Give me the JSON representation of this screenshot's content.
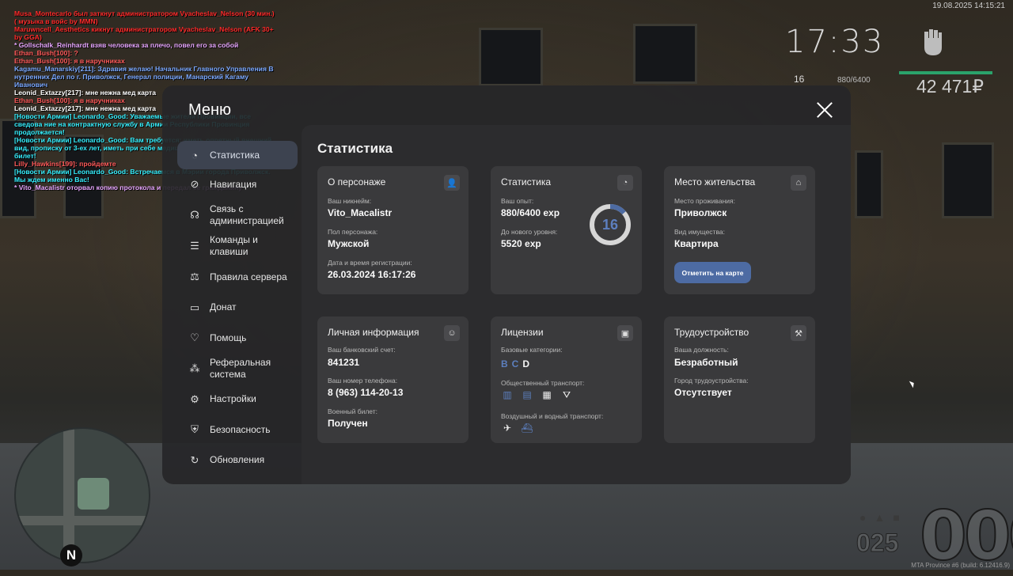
{
  "chat": [
    {
      "text": "Musa_Montecarlo был заткнут администратором Vyacheslav_Nelson (30 мин.) ( музыка в войс by MMN)",
      "color": "#ff2a2a"
    },
    {
      "text": "Maruwncell_Aesthetics кикнут администратором Vyacheslav_Nelson (AFK 30+ by GGA)",
      "color": "#ff2a2a"
    },
    {
      "text": "* Gollschalk_Reinhardt взяв человека за плечо, повел его за собой",
      "color": "#e7a6ff"
    },
    {
      "text": "Ethan_Bush[100]: ?",
      "color": "#ff5a5a"
    },
    {
      "text": "Ethan_Bush[100]: я в наручниках",
      "color": "#ff5a5a"
    },
    {
      "text": "Kagamu_Manarskiy[211]: Здравия желаю! Начальник Главного Управления В нутренних Дел по г. Приволжск, Генерал полиции, Манарский Кагаму Иванович",
      "color": "#7aa8ff"
    },
    {
      "text": "Leonid_Extazzy[217]: мне нежна мед карта",
      "color": "#ffffff"
    },
    {
      "text": "Ethan_Bush[100]: я в наручниках",
      "color": "#ff5a5a"
    },
    {
      "text": "Leonid_Extazzy[217]: мне нежна мед карта",
      "color": "#ffffff"
    },
    {
      "text": "[Новости Армии] Leonardo_Good: Уважаемые жители Провинции, все сведова ние на контрактную службу в Армии Республики Провинция продолжается!",
      "color": "#35f0ff"
    },
    {
      "text": "[Новости Армии] Leonardo_Good: Вам требуется: иметь опрятный внешний вид, прописку от 3-ех лет, иметь при себе медицинскую карточку и военный билет!",
      "color": "#35f0ff"
    },
    {
      "text": "Lilly_Hawkins[199]: пройдемте",
      "color": "#ff5a5a"
    },
    {
      "text": "[Новости Армии] Leonardo_Good: Встречаемся в Мэрии города Приволжск. Мы ждем именно Вас!",
      "color": "#35f0ff"
    },
    {
      "text": "* Vito_Macalistr оторвал копию протокола и передал ее гражданину",
      "color": "#e7a6ff"
    }
  ],
  "hud": {
    "datetime": "19.08.2025 14:15:21",
    "clock": "17:33",
    "level": "16",
    "exp": "880/6400",
    "money": "42 471₽",
    "speed": "000",
    "fuel": "025",
    "build": "MTA Province #6 (build: 6.12416.9)",
    "compass": "N"
  },
  "menu": {
    "title": "Меню",
    "nav": [
      {
        "label": "Статистика",
        "icon": "pie-chart-icon",
        "active": true
      },
      {
        "label": "Навигация",
        "icon": "compass-icon"
      },
      {
        "label": "Связь с администрацией",
        "icon": "headset-icon"
      },
      {
        "label": "Команды и клавиши",
        "icon": "document-icon"
      },
      {
        "label": "Правила сервера",
        "icon": "scales-icon"
      },
      {
        "label": "Донат",
        "icon": "wallet-icon"
      },
      {
        "label": "Помощь",
        "icon": "heart-hand-icon"
      },
      {
        "label": "Реферальная система",
        "icon": "network-icon"
      },
      {
        "label": "Настройки",
        "icon": "gear-icon"
      },
      {
        "label": "Безопасность",
        "icon": "shield-icon"
      },
      {
        "label": "Обновления",
        "icon": "refresh-check-icon"
      }
    ]
  },
  "stats": {
    "heading": "Статистика",
    "character": {
      "title": "О персонаже",
      "nick_label": "Ваш никнейм:",
      "nick": "Vito_Macalistr",
      "sex_label": "Пол персонажа:",
      "sex": "Мужской",
      "reg_label": "Дата и время регистрации:",
      "reg": "26.03.2024 16:17:26"
    },
    "stat": {
      "title": "Статистика",
      "exp_label": "Ваш опыт:",
      "exp": "880/6400 exp",
      "next_label": "До нового уровня:",
      "next": "5520 exp",
      "level": "16",
      "progress": 0.1375,
      "accent": "#4d6ba3"
    },
    "residence": {
      "title": "Место жительства",
      "place_label": "Место проживания:",
      "place": "Приволжск",
      "prop_label": "Вид имущества:",
      "prop": "Квартира",
      "map_button": "Отметить на карте"
    },
    "personal": {
      "title": "Личная информация",
      "bank_label": "Ваш банковский счет:",
      "bank": "841231",
      "phone_label": "Ваш номер телефона:",
      "phone": "8 (963) 114-20-13",
      "military_label": "Военный билет:",
      "military": "Получен"
    },
    "licenses": {
      "title": "Лицензии",
      "base_label": "Базовые категории:",
      "categories": [
        "B",
        "C",
        "D"
      ],
      "public_label": "Общественный транспорт:",
      "air_label": "Воздушный и водный транспорт:"
    },
    "job": {
      "title": "Трудоустройство",
      "position_label": "Ваша должность:",
      "position": "Безработный",
      "city_label": "Город трудоустройства:",
      "city": "Отсутствует"
    }
  }
}
